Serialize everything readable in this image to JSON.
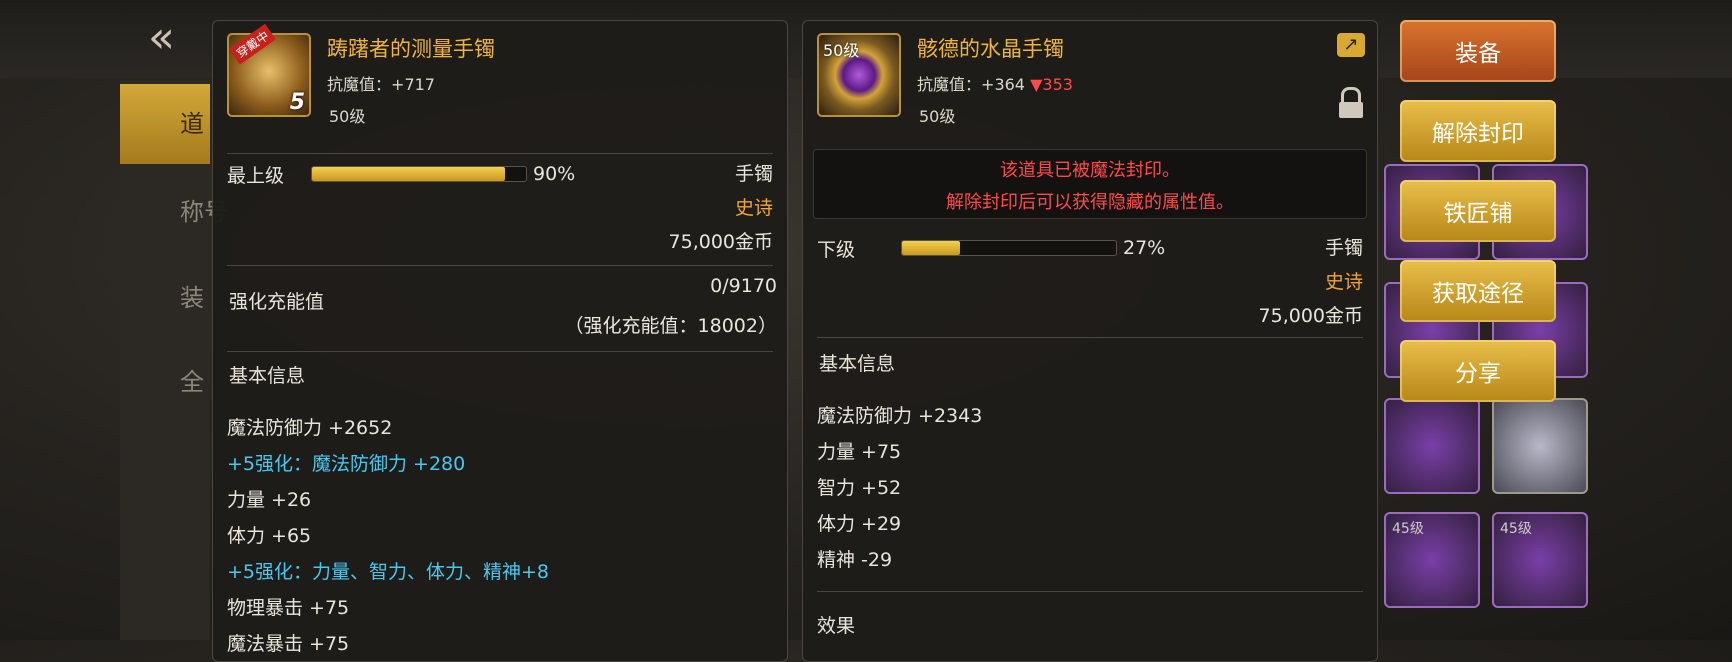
{
  "nav": {
    "back_icon": "back-arrow-icon",
    "side_items": [
      "道",
      "称号",
      "装",
      "全"
    ]
  },
  "left": {
    "badge": "穿戴中",
    "plus": "5",
    "name": "踌躇者的测量手镯",
    "resist_label": "抗魔值",
    "resist_value": "+717",
    "level": "50级",
    "grade_label": "最上级",
    "grade_pct": 90,
    "grade_pct_text": "90%",
    "slot": "手镯",
    "rarity": "史诗",
    "price": "75,000金币",
    "charge_label": "强化充能值",
    "charge_value": "0/9170",
    "charge_sub": "（强化充能值：18002）",
    "basic_title": "基本信息",
    "stats": [
      {
        "text": "魔法防御力 +2652",
        "type": "normal"
      },
      {
        "text": "+5强化：魔法防御力 +280",
        "type": "enh"
      },
      {
        "text": "力量 +26",
        "type": "normal"
      },
      {
        "text": "体力 +65",
        "type": "normal"
      },
      {
        "text": "+5强化：力量、智力、体力、精神+8",
        "type": "enh"
      },
      {
        "text": "物理暴击 +75",
        "type": "normal"
      },
      {
        "text": "魔法暴击 +75",
        "type": "normal"
      }
    ]
  },
  "right": {
    "level_badge": "50级",
    "name": "骸德的水晶手镯",
    "resist_label": "抗魔值",
    "resist_value": "+364",
    "resist_diff": "▼353",
    "level": "50级",
    "seal_line1": "该道具已被魔法封印。",
    "seal_line2": "解除封印后可以获得隐藏的属性值。",
    "grade_label": "下级",
    "grade_pct": 27,
    "grade_pct_text": "27%",
    "slot": "手镯",
    "rarity": "史诗",
    "price": "75,000金币",
    "basic_title": "基本信息",
    "stats": [
      "魔法防御力 +2343",
      "力量 +75",
      "智力 +52",
      "体力 +29",
      "精神 -29"
    ],
    "effect_title": "效果"
  },
  "buttons": [
    {
      "label": "装备",
      "style": "red"
    },
    {
      "label": "解除封印",
      "style": "gold"
    },
    {
      "label": "铁匠铺",
      "style": "gold"
    },
    {
      "label": "获取途径",
      "style": "gold"
    },
    {
      "label": "分享",
      "style": "gold"
    }
  ],
  "bg_slot_labels": [
    "45级",
    "45级"
  ]
}
